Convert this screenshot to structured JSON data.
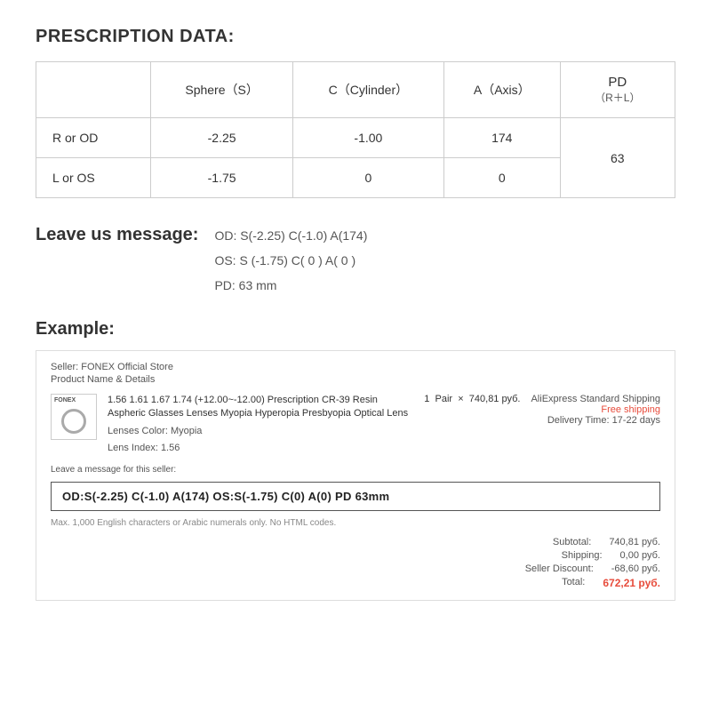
{
  "prescription": {
    "title": "PRESCRIPTION DATA:",
    "headers": {
      "sphere": "Sphere（S）",
      "cylinder": "C（Cylinder）",
      "axis": "A（Axis）",
      "pd": "PD",
      "pd_sub": "（R＋L）"
    },
    "rows": [
      {
        "label": "R or OD",
        "sphere": "-2.25",
        "cylinder": "-1.00",
        "axis": "174",
        "pd": ""
      },
      {
        "label": "L or OS",
        "sphere": "-1.75",
        "cylinder": "0",
        "axis": "0",
        "pd": "63"
      }
    ]
  },
  "message": {
    "label": "Leave us message:",
    "lines": [
      "OD:  S(-2.25)    C(-1.0)   A(174)",
      "OS:  S (-1.75)    C( 0 )    A( 0 )",
      "PD:  63 mm"
    ]
  },
  "example": {
    "title": "Example:",
    "seller": "Seller: FONEX Official Store",
    "product_label": "Product Name & Details",
    "brand": "FONEX",
    "description": "1.56 1.61 1.67 1.74 (+12.00~-12.00) Prescription CR-39 Resin Aspheric Glasses Lenses Myopia Hyperopia Presbyopia Optical Lens",
    "lenses_color_label": "Lenses Color:",
    "lenses_color_value": "Myopia",
    "lens_index_label": "Lens Index:",
    "lens_index_value": "1.56",
    "quantity": "1",
    "unit": "Pair",
    "multiply": "×",
    "price": "740,81 руб.",
    "shipping_option": "AliExpress Standard Shipping",
    "free_shipping": "Free shipping",
    "delivery": "Delivery Time: 17-22 days",
    "message_box_label": "Leave a message for this seller:",
    "message_box_content": "OD:S(-2.25) C(-1.0) A(174)   OS:S(-1.75) C(0) A(0)   PD  63mm",
    "message_hint": "Max. 1,000 English characters or Arabic numerals only. No HTML codes.",
    "totals": {
      "subtotal_label": "Subtotal:",
      "subtotal_value": "740,81 руб.",
      "shipping_label": "Shipping:",
      "shipping_value": "0,00 руб.",
      "discount_label": "Seller Discount:",
      "discount_value": "-68,60 руб.",
      "total_label": "Total:",
      "total_value": "672,21 руб."
    }
  }
}
